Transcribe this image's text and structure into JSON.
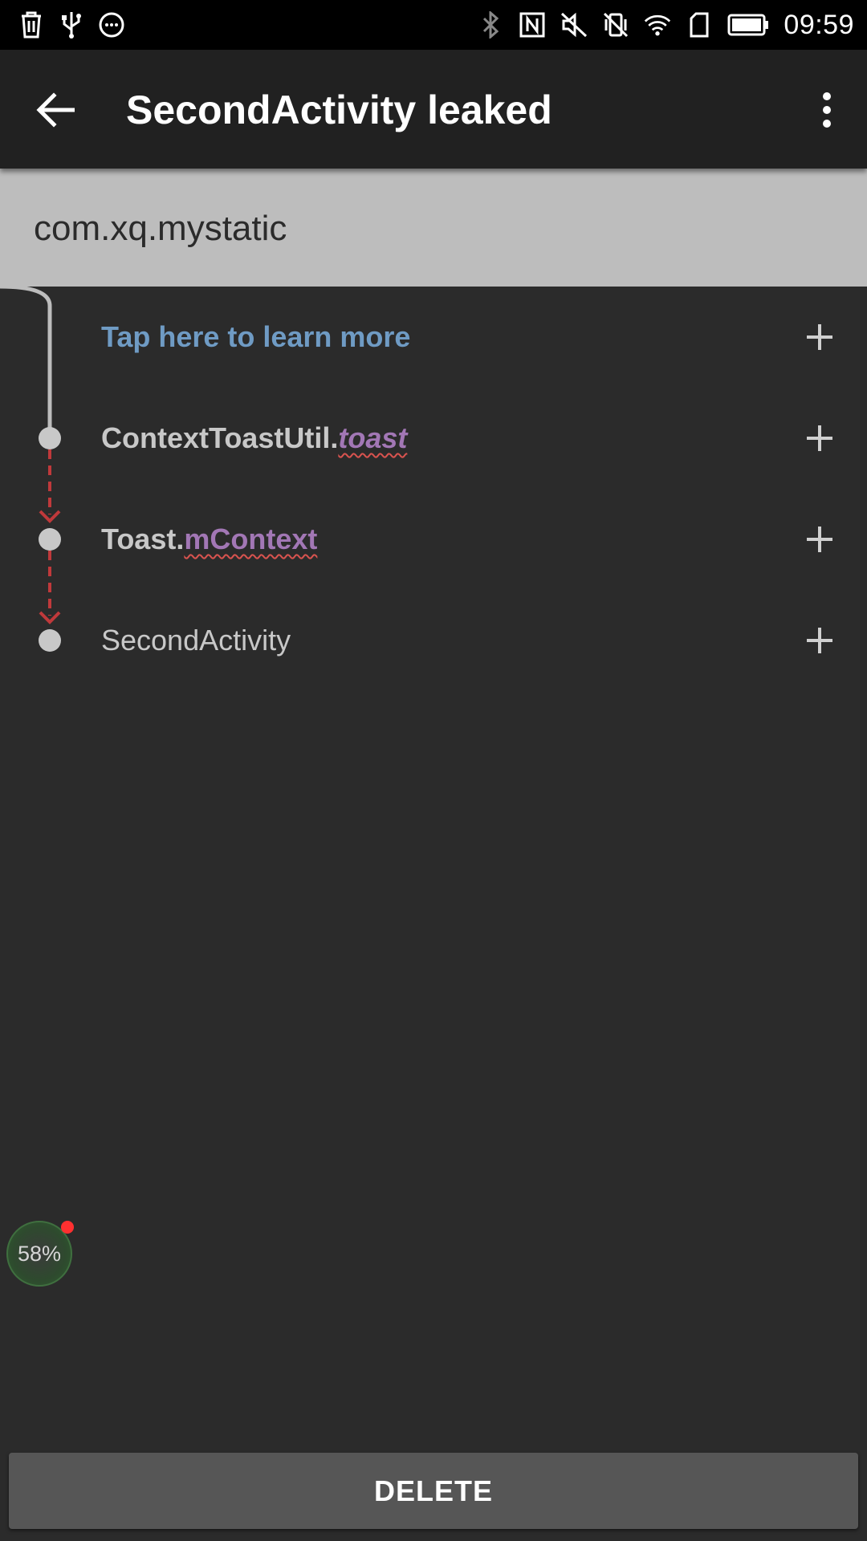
{
  "status_bar": {
    "time": "09:59",
    "left_icons": [
      "trash-icon",
      "usb-icon",
      "chat-icon"
    ],
    "right_icons": [
      "bluetooth-icon",
      "nfc-icon",
      "mute-icon",
      "vibrate-off-icon",
      "wifi-icon",
      "sim-icon",
      "battery-icon"
    ]
  },
  "app_bar": {
    "title": "SecondActivity leaked",
    "back_icon": "arrow-back-icon",
    "menu_icon": "more-vert-icon"
  },
  "package": {
    "name": "com.xq.mystatic"
  },
  "trace": {
    "rows": [
      {
        "type": "learn",
        "text": "Tap here to learn more"
      },
      {
        "type": "reference",
        "class_name": "ContextToastUtil.",
        "field": "toast",
        "field_italic": true
      },
      {
        "type": "reference",
        "class_name": "Toast.",
        "field": "mContext",
        "field_italic": false
      },
      {
        "type": "leaked",
        "text": "SecondActivity"
      }
    ],
    "expand_icon": "plus-icon"
  },
  "floating_badge": {
    "text": "58%"
  },
  "actions": {
    "delete_label": "DELETE"
  },
  "colors": {
    "background": "#2b2b2b",
    "app_bar": "#212121",
    "package_header": "#bdbdbd",
    "link": "#6f9bc4",
    "field": "#a277b5",
    "leak_arrow": "#c0393b",
    "button": "#565656"
  }
}
